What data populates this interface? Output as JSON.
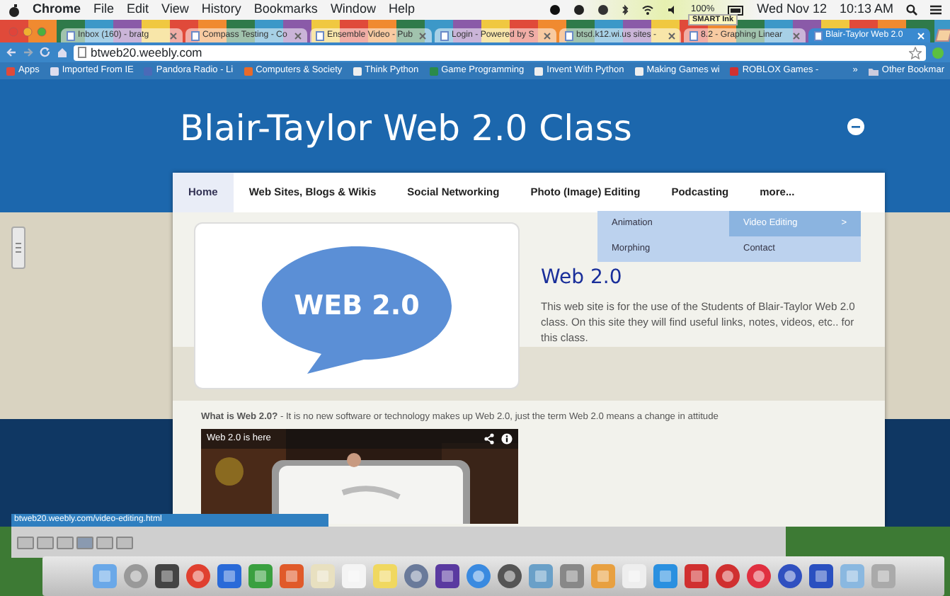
{
  "menubar": {
    "app": "Chrome",
    "menus": [
      "File",
      "Edit",
      "View",
      "History",
      "Bookmarks",
      "Window",
      "Help"
    ],
    "battery": "100%",
    "date": "Wed Nov 12",
    "time": "10:13 AM"
  },
  "tooltip": "SMART Ink",
  "tabs": [
    {
      "label": "Inbox (160) - bratg",
      "selected": false
    },
    {
      "label": "Compass Testing - Co",
      "selected": false
    },
    {
      "label": "Ensemble Video - Pub",
      "selected": false
    },
    {
      "label": "Login - Powered by S",
      "selected": false
    },
    {
      "label": "btsd.k12.wi.us sites -",
      "selected": false
    },
    {
      "label": "8.2 - Graphing Linear",
      "selected": false
    },
    {
      "label": "Blair-Taylor Web 2.0",
      "selected": true
    }
  ],
  "address": "btweb20.weebly.com",
  "bookmarks": [
    "Apps",
    "Imported From IE",
    "Pandora Radio - Li",
    "Computers & Society",
    "Think Python",
    "Game Programming",
    "Invent With Python",
    "Making Games wi",
    "ROBLOX Games -"
  ],
  "bookmarks_overflow": "»",
  "other_bookmarks": "Other Bookmar",
  "site": {
    "title": "Blair-Taylor Web 2.0 Class",
    "nav": [
      {
        "label": "Home",
        "selected": true
      },
      {
        "label": "Web Sites, Blogs & Wikis",
        "selected": false
      },
      {
        "label": "Social Networking",
        "selected": false
      },
      {
        "label": "Photo (Image) Editing",
        "selected": false
      },
      {
        "label": "Podcasting",
        "selected": false
      },
      {
        "label": "more...",
        "selected": false
      }
    ],
    "dropdown": [
      {
        "label": "Animation",
        "selected": false
      },
      {
        "label": "Video Editing",
        "selected": true,
        "submenu_mark": ">"
      },
      {
        "label": "Morphing",
        "selected": false
      },
      {
        "label": "Contact",
        "selected": false
      }
    ],
    "logo_text": "WEB 2.0",
    "heading": "Web 2.0",
    "paragraph": "This web site is for the use of the Students of Blair-Taylor Web 2.0 class. On this site they will find useful links, notes, videos, etc.. for this class.",
    "intro": "**What is Web 2.0?** - It is no new software or technology makes up Web 2.0, just the term Web 2.0 means a change in attitude",
    "video": {
      "title": "Web 2.0 is here"
    }
  },
  "status_url": "btweb20.weebly.com/video-editing.html"
}
